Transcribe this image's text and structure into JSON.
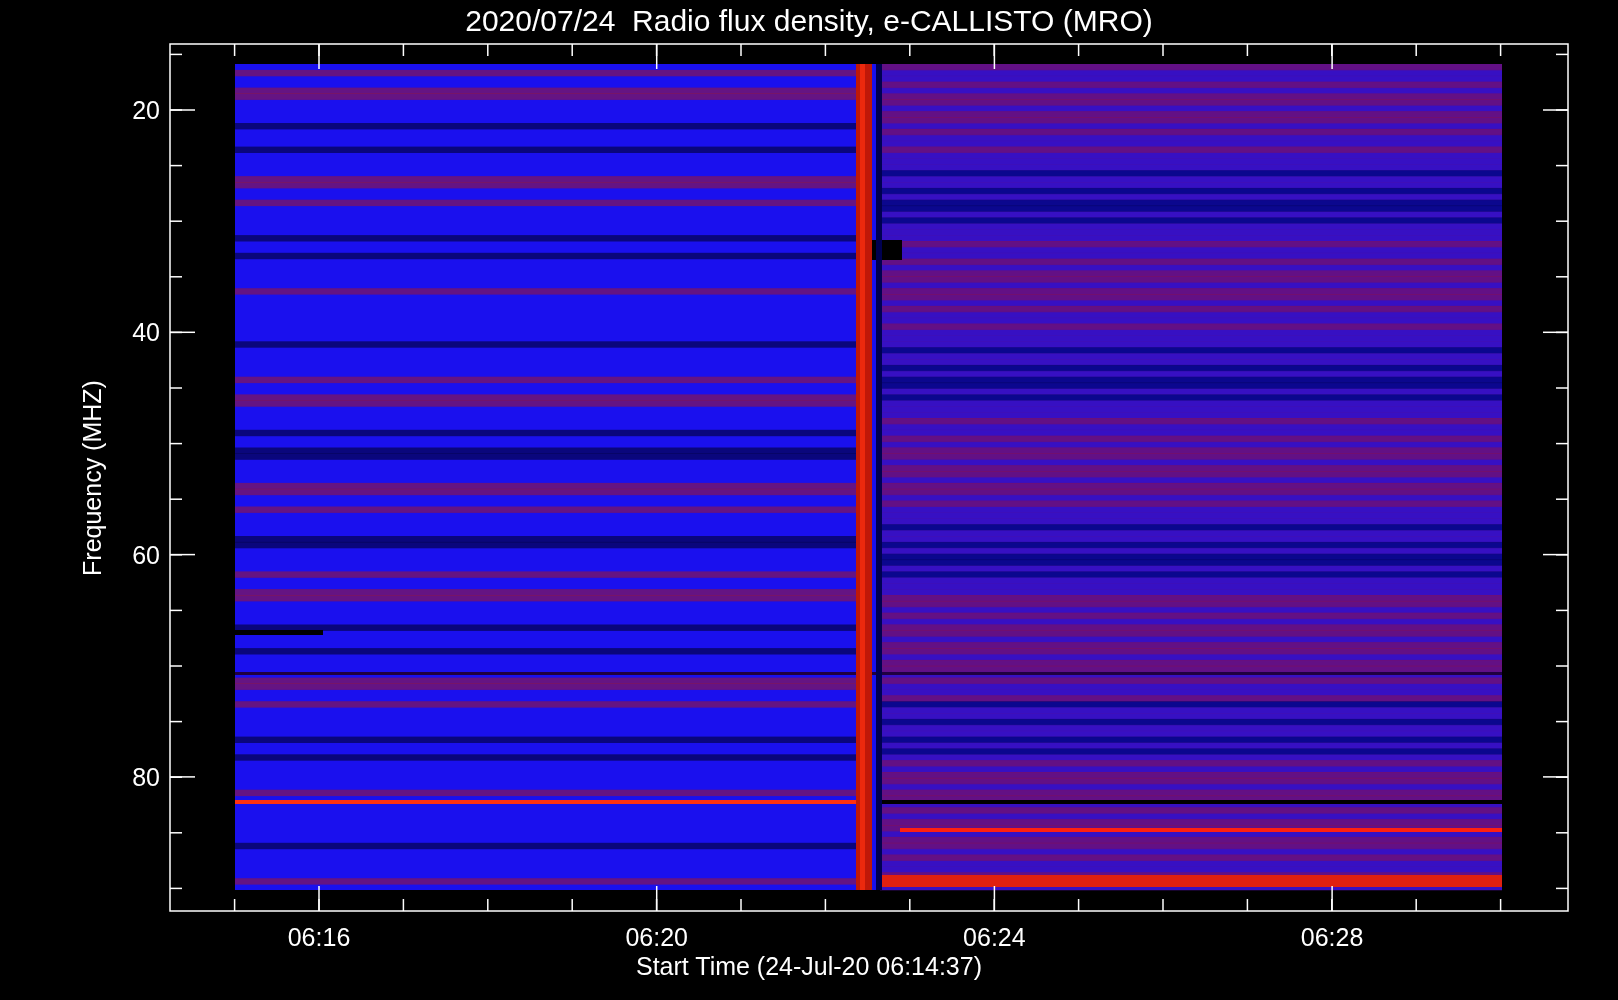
{
  "chart": {
    "title": "2020/07/24  Radio flux density, e-CALLISTO (MRO)",
    "ylabel": "Frequency (MHZ)",
    "xlabel": "Start Time (24-Jul-20 06:14:37)",
    "yticks": [
      "20",
      "40",
      "60",
      "80"
    ],
    "xticks": [
      "06:16",
      "06:20",
      "06:24",
      "06:28"
    ]
  }
}
